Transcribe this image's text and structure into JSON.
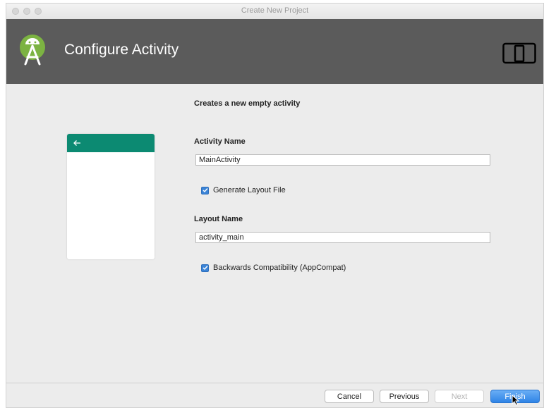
{
  "window": {
    "title": "Create New Project"
  },
  "header": {
    "title": "Configure Activity",
    "logo_icon": "android-studio-logo",
    "device_icon": "device-preview-icon",
    "background": "#5b5b5b"
  },
  "preview": {
    "appbar_color": "#0c8a72",
    "back_icon": "arrow-left-icon"
  },
  "form": {
    "subtitle": "Creates a new empty activity",
    "activity_name_label": "Activity Name",
    "activity_name_value": "MainActivity",
    "generate_layout_label": "Generate Layout File",
    "generate_layout_checked": true,
    "layout_name_label": "Layout Name",
    "layout_name_value": "activity_main",
    "backwards_compat_label": "Backwards Compatibility (AppCompat)",
    "backwards_compat_checked": true
  },
  "footer": {
    "cancel": "Cancel",
    "previous": "Previous",
    "next": "Next",
    "finish": "Finish"
  },
  "colors": {
    "accent": "#3b84d7",
    "primary_button": "#2f84e6"
  }
}
